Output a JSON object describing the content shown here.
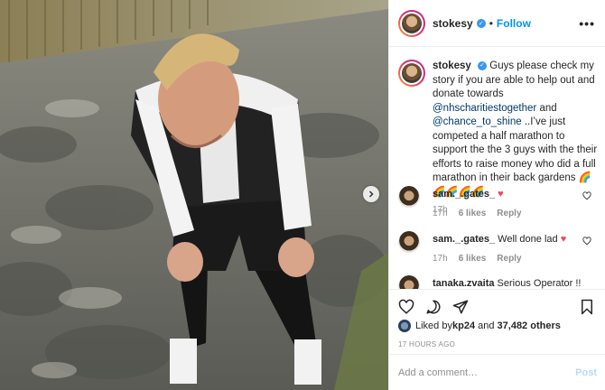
{
  "header": {
    "username": "stokesy",
    "separator": "•",
    "follow_label": "Follow",
    "more_label": "•••"
  },
  "caption": {
    "username": "stokesy",
    "text_1": "Guys please check my story if you are able to help out and donate towards ",
    "mention_1": "@nhscharitiestogether",
    "text_2": " and ",
    "mention_2": "@chance_to_shine",
    "text_3": " ..I’ve just competed a half marathon to support the the 3 guys with the their efforts to raise money who did a full marathon in their back gardens ",
    "emoji": "🌈🌈🌈🌈🌈",
    "time": "17h"
  },
  "comments": [
    {
      "username": "sam._.gates_",
      "text": "",
      "heart": "♥",
      "time": "17h",
      "likes": "6 likes",
      "reply": "Reply"
    },
    {
      "username": "sam._.gates_",
      "text": "Well done lad",
      "heart": "♥",
      "time": "17h",
      "likes": "6 likes",
      "reply": "Reply"
    },
    {
      "username": "tanaka.zvaita",
      "text": "Serious Operator !!"
    }
  ],
  "likes": {
    "prefix": "Liked by ",
    "user": "kp24",
    "middle": " and ",
    "count": "37,482 others"
  },
  "timestamp": "17 HOURS AGO",
  "comment_input": {
    "placeholder": "Add a comment…",
    "post_label": "Post"
  },
  "colors": {
    "accent": "#0095f6",
    "verified": "#3897f0",
    "heart": "#ed4956"
  }
}
